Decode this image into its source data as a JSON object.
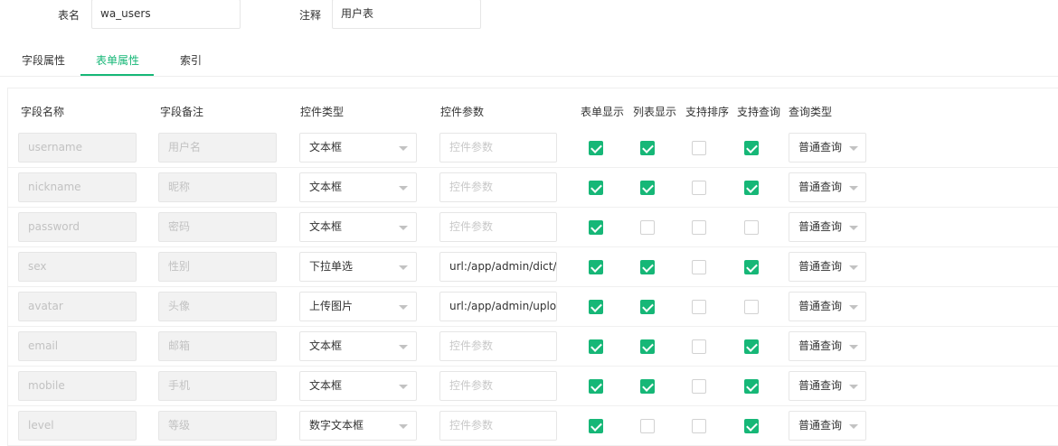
{
  "form": {
    "table_name_label": "表名",
    "table_name_value": "wa_users",
    "comment_label": "注释",
    "comment_value": "用户表"
  },
  "tabs": [
    {
      "label": "字段属性",
      "active": false
    },
    {
      "label": "表单属性",
      "active": true
    },
    {
      "label": "索引",
      "active": false
    }
  ],
  "colors": {
    "accent": "#16b777"
  },
  "headers": {
    "field_name": "字段名称",
    "field_comment": "字段备注",
    "control_type": "控件类型",
    "control_params": "控件参数",
    "form_show": "表单显示",
    "list_show": "列表显示",
    "sortable": "支持排序",
    "searchable": "支持查询",
    "query_type": "查询类型"
  },
  "param_placeholder": "控件参数",
  "rows": [
    {
      "name": "username",
      "comment": "用户名",
      "control": "文本框",
      "params": "",
      "form": true,
      "list": true,
      "sort": false,
      "search": true,
      "query": "普通查询"
    },
    {
      "name": "nickname",
      "comment": "昵称",
      "control": "文本框",
      "params": "",
      "form": true,
      "list": true,
      "sort": false,
      "search": true,
      "query": "普通查询"
    },
    {
      "name": "password",
      "comment": "密码",
      "control": "文本框",
      "params": "",
      "form": true,
      "list": false,
      "sort": false,
      "search": false,
      "query": "普通查询"
    },
    {
      "name": "sex",
      "comment": "性别",
      "control": "下拉单选",
      "params": "url:/app/admin/dict/get",
      "form": true,
      "list": true,
      "sort": false,
      "search": true,
      "query": "普通查询"
    },
    {
      "name": "avatar",
      "comment": "头像",
      "control": "上传图片",
      "params": "url:/app/admin/upload/",
      "form": true,
      "list": true,
      "sort": false,
      "search": false,
      "query": "普通查询"
    },
    {
      "name": "email",
      "comment": "邮箱",
      "control": "文本框",
      "params": "",
      "form": true,
      "list": true,
      "sort": false,
      "search": true,
      "query": "普通查询"
    },
    {
      "name": "mobile",
      "comment": "手机",
      "control": "文本框",
      "params": "",
      "form": true,
      "list": true,
      "sort": false,
      "search": true,
      "query": "普通查询"
    },
    {
      "name": "level",
      "comment": "等级",
      "control": "数字文本框",
      "params": "",
      "form": true,
      "list": false,
      "sort": false,
      "search": true,
      "query": "普通查询"
    }
  ]
}
